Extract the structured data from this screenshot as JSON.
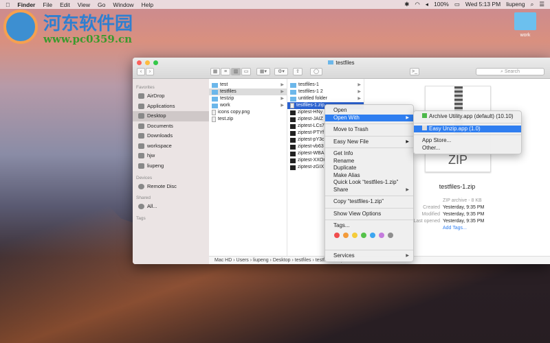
{
  "menubar": {
    "app": "Finder",
    "items": [
      "File",
      "Edit",
      "View",
      "Go",
      "Window",
      "Help"
    ],
    "battery": "100%",
    "clock": "Wed 5:13 PM",
    "user": "liupeng"
  },
  "watermark": {
    "name": "河东软件园",
    "url": "www.pc0359.cn"
  },
  "desktop_icon": "work",
  "window": {
    "title": "testfiles",
    "search_placeholder": "Search"
  },
  "sidebar": {
    "favorites_header": "Favorites",
    "favorites": [
      "AirDrop",
      "Applications",
      "Desktop",
      "Documents",
      "Downloads",
      "workspace",
      "hjw",
      "liupeng"
    ],
    "devices_header": "Devices",
    "devices": [
      "Remote Disc"
    ],
    "shared_header": "Shared",
    "shared": [
      "All..."
    ],
    "tags_header": "Tags"
  },
  "column1": [
    {
      "name": "test",
      "type": "folder"
    },
    {
      "name": "testfiles",
      "type": "folder"
    },
    {
      "name": "testzip",
      "type": "folder"
    },
    {
      "name": "work",
      "type": "folder"
    },
    {
      "name": "icons copy.png",
      "type": "file"
    },
    {
      "name": "test.zip",
      "type": "file"
    }
  ],
  "column2": [
    {
      "name": "testfiles-1",
      "type": "folder"
    },
    {
      "name": "testfiles-1 2",
      "type": "folder"
    },
    {
      "name": "untitled folder",
      "type": "folder"
    },
    {
      "name": "testfiles-1.zip",
      "type": "file"
    },
    {
      "name": "ziptest-HNy",
      "type": "exe"
    },
    {
      "name": "ziptest-JAIZ",
      "type": "exe"
    },
    {
      "name": "ziptest-LCs7",
      "type": "exe"
    },
    {
      "name": "ziptest-PTYf",
      "type": "exe"
    },
    {
      "name": "ziptest-pY3c",
      "type": "exe"
    },
    {
      "name": "ziptest-vb63",
      "type": "exe"
    },
    {
      "name": "ziptest-WBA",
      "type": "exe"
    },
    {
      "name": "ziptest-XXOr",
      "type": "exe"
    },
    {
      "name": "ziptest-zGIX",
      "type": "exe"
    }
  ],
  "preview": {
    "icon_label": "ZIP",
    "filename": "testfiles-1.zip",
    "kind": "ZIP archive - 8 KB",
    "created_label": "Created",
    "created": "Yesterday, 9:35 PM",
    "modified_label": "Modified",
    "modified": "Yesterday, 9:35 PM",
    "opened_label": "Last opened",
    "opened": "Yesterday, 9:35 PM",
    "add_tags": "Add Tags..."
  },
  "pathbar": [
    "Mac HD",
    "Users",
    "liupeng",
    "Desktop",
    "testfiles",
    "testfiles-1.zip"
  ],
  "context_menu": {
    "open": "Open",
    "open_with": "Open With",
    "trash": "Move to Trash",
    "easy_new": "Easy New File",
    "get_info": "Get Info",
    "rename": "Rename",
    "duplicate": "Duplicate",
    "alias": "Make Alias",
    "quicklook": "Quick Look “testfiles-1.zip”",
    "share": "Share",
    "copy": "Copy “testfiles-1.zip”",
    "view_options": "Show View Options",
    "tags": "Tags...",
    "services": "Services",
    "tag_colors": [
      "#f04d4d",
      "#f39b3a",
      "#f5cc3a",
      "#55c24a",
      "#3ca6f0",
      "#c47bdc",
      "#8e8e8e"
    ]
  },
  "submenu": {
    "archive": "Archive Utility.app (default) (10.10)",
    "easy_unzip": "Easy Unzip.app (1.0)",
    "app_store": "App Store...",
    "other": "Other..."
  }
}
